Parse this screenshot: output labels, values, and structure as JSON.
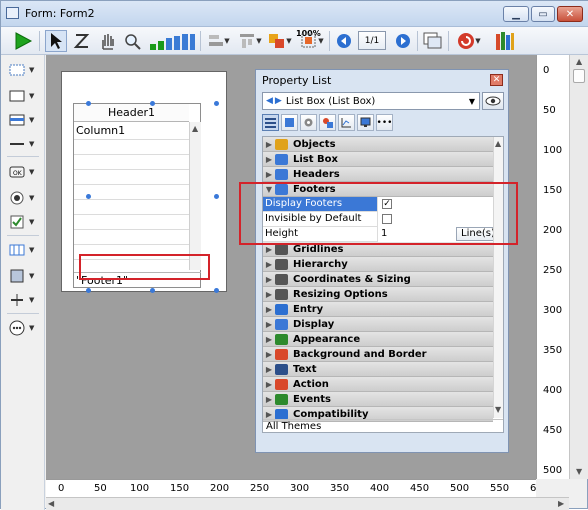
{
  "window": {
    "title": "Form: Form2"
  },
  "toolbar": {
    "zoom_label": "100%",
    "page_indicator": "1/1"
  },
  "form": {
    "listbox_header": "Header1",
    "listbox_column": "Column1",
    "listbox_footer": "\"Footer1\""
  },
  "ruler_right": {
    "ticks": [
      "0",
      "50",
      "100",
      "150",
      "200",
      "250",
      "300",
      "350",
      "400",
      "450",
      "500"
    ]
  },
  "ruler_bottom": {
    "ticks": [
      "0",
      "50",
      "100",
      "150",
      "200",
      "250",
      "300",
      "350",
      "400",
      "450",
      "500",
      "550",
      "6"
    ]
  },
  "property_list": {
    "title": "Property List",
    "selector": "List Box (List Box)",
    "categories_top": [
      "Objects",
      "List Box",
      "Headers"
    ],
    "expanded_category": "Footers",
    "properties": [
      {
        "name": "Display Footers",
        "value": "checked"
      },
      {
        "name": "Invisible by Default",
        "value": "unchecked"
      },
      {
        "name": "Height",
        "value": "1",
        "unit": "Line(s)"
      }
    ],
    "categories_bottom": [
      "Gridlines",
      "Hierarchy",
      "Coordinates & Sizing",
      "Resizing Options",
      "Entry",
      "Display",
      "Appearance",
      "Background and Border",
      "Text",
      "Action",
      "Events",
      "Compatibility"
    ],
    "status": "All Themes"
  },
  "colors": {
    "highlight": "#d4232a",
    "selection": "#3b78d6",
    "canvas": "#9e9e9e"
  }
}
